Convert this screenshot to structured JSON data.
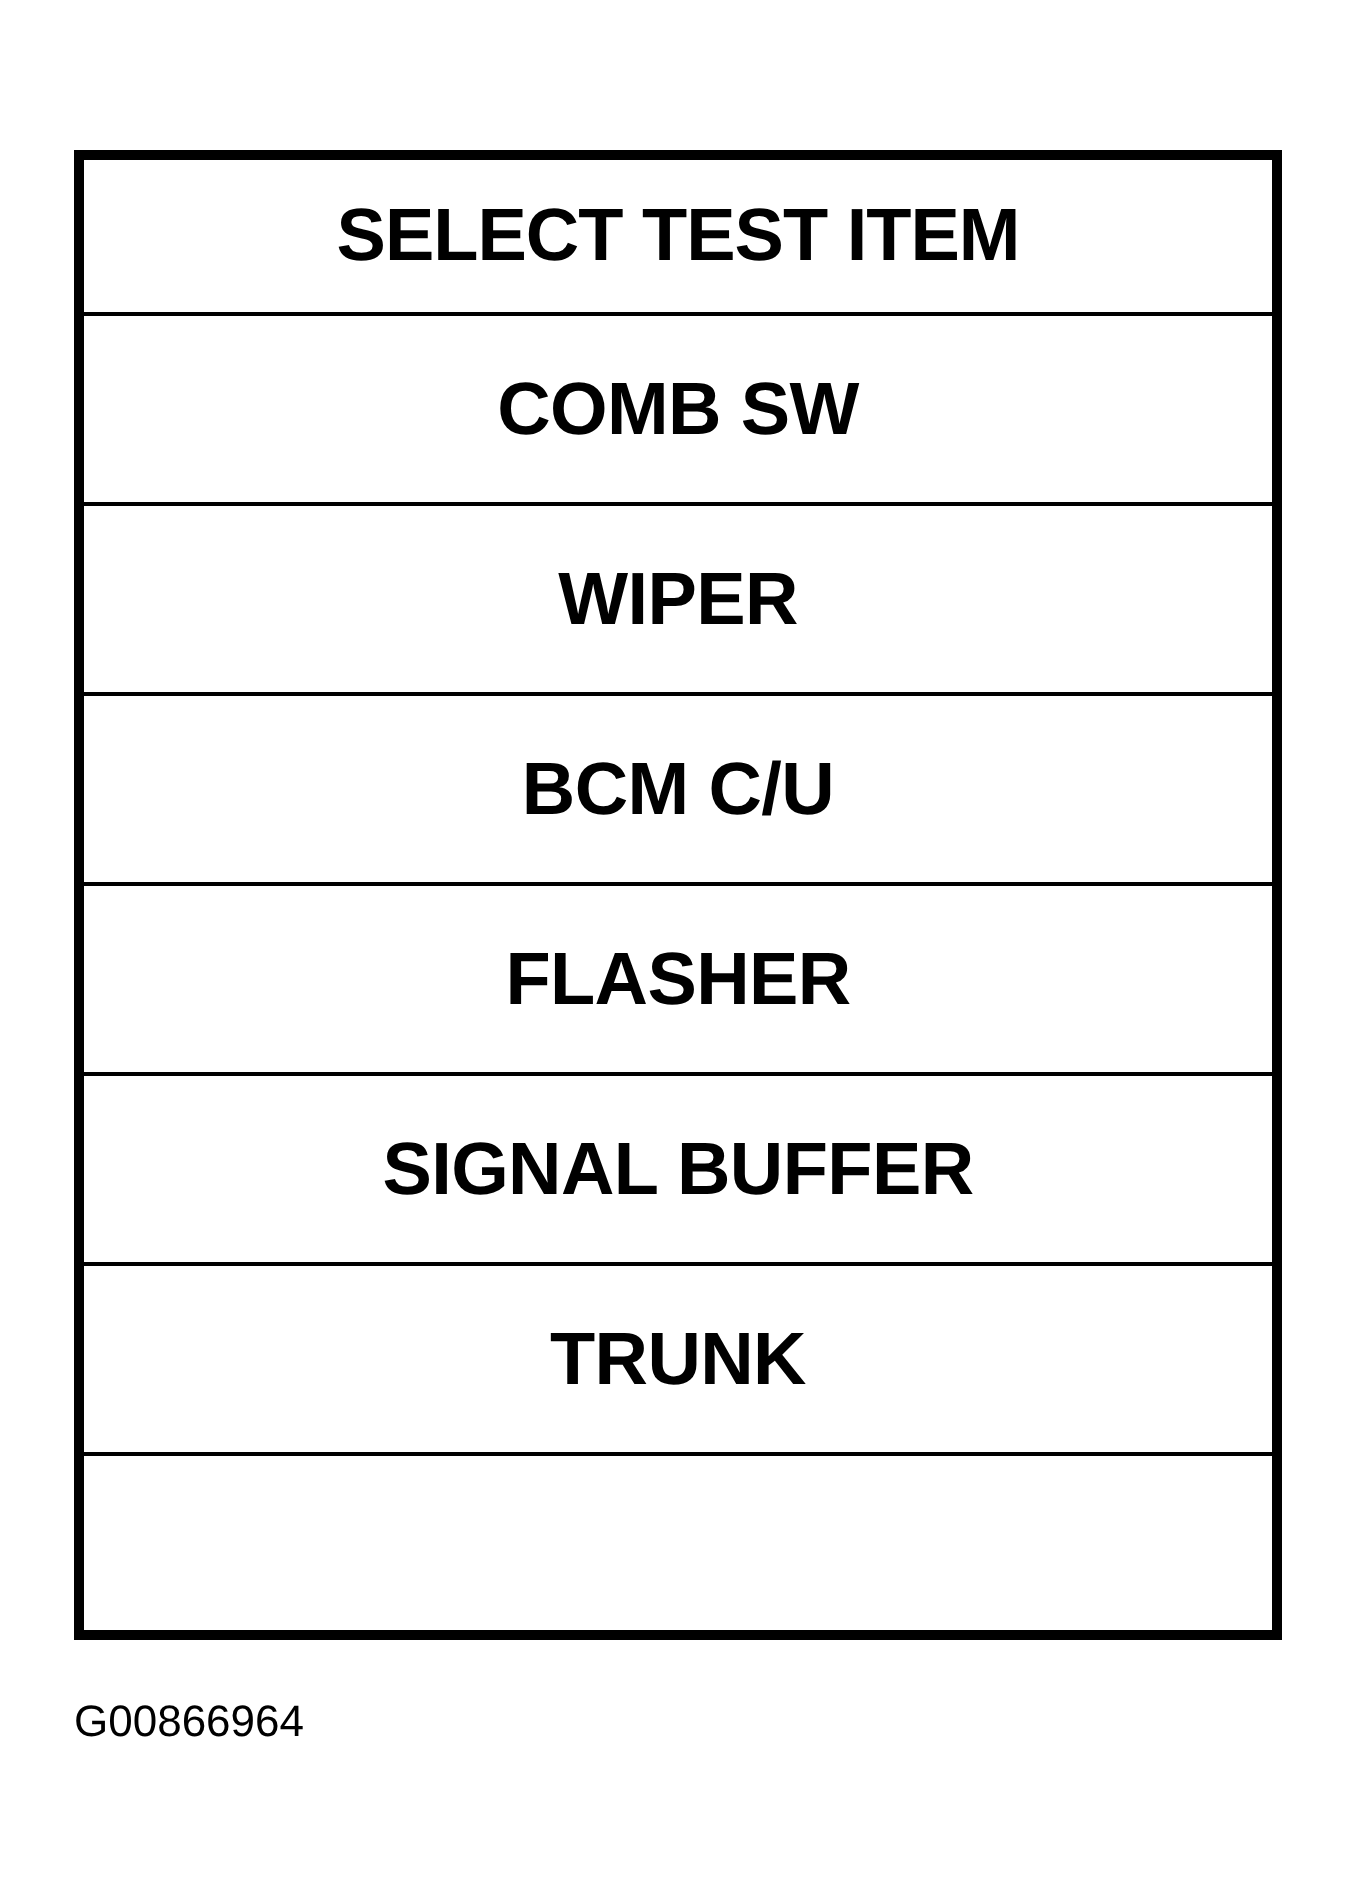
{
  "menu": {
    "title": "SELECT TEST ITEM",
    "items": [
      "COMB SW",
      "WIPER",
      "BCM C/U",
      "FLASHER",
      "SIGNAL BUFFER",
      "TRUNK"
    ]
  },
  "figure_code": "G00866964"
}
